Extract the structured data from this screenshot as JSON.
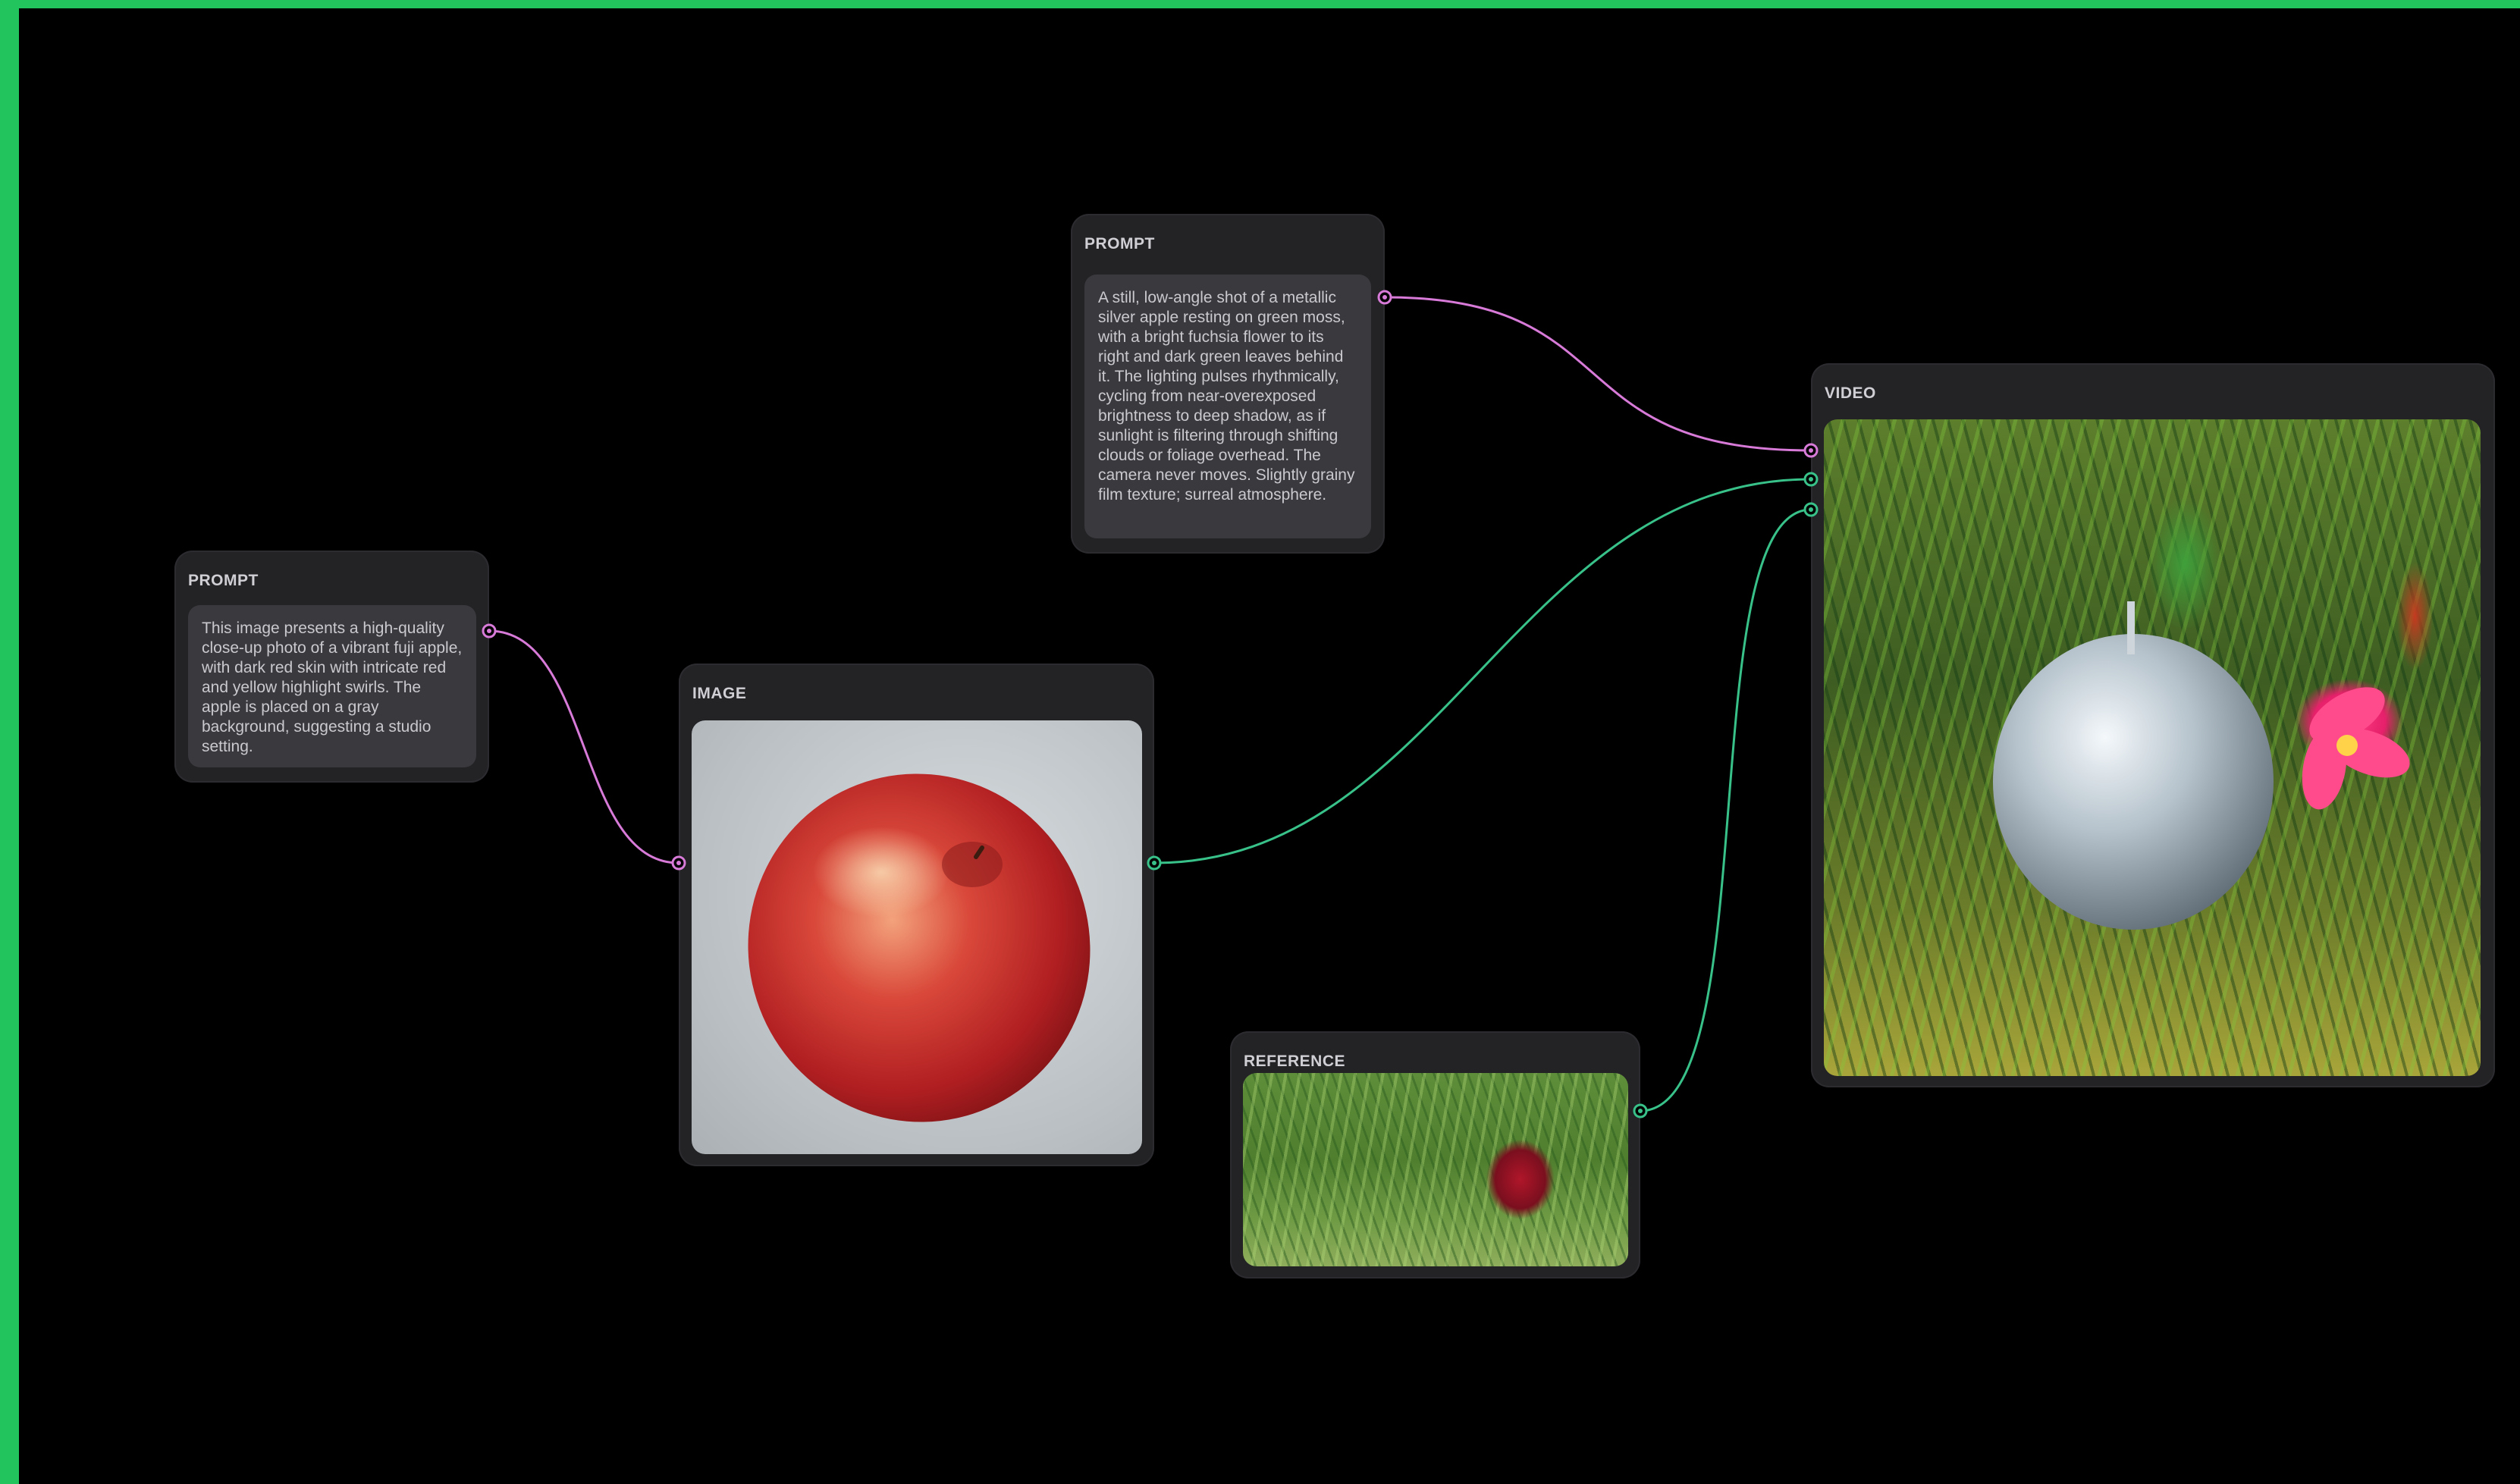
{
  "canvas": {
    "accent_frame_color": "#22c45e",
    "background": "#000000"
  },
  "wire_colors": {
    "text": "#d77ad8",
    "media": "#38c28a"
  },
  "nodes": {
    "prompt1": {
      "title": "PROMPT",
      "text": "This image presents a high-quality close-up photo of a vibrant fuji apple, with dark red skin with intricate red and yellow highlight swirls. The apple is placed on a gray background, suggesting a studio setting."
    },
    "prompt2": {
      "title": "PROMPT",
      "text": "A still, low-angle shot of a metallic silver apple resting on green moss, with a bright fuchsia flower to its right and dark green leaves behind it. The lighting pulses rhythmically, cycling from near-overexposed brightness to deep shadow, as if sunlight is filtering through shifting clouds or foliage overhead. The camera never moves. Slightly grainy film texture; surreal atmosphere."
    },
    "image": {
      "title": "IMAGE"
    },
    "reference": {
      "title": "REFERENCE"
    },
    "video": {
      "title": "VIDEO"
    }
  }
}
